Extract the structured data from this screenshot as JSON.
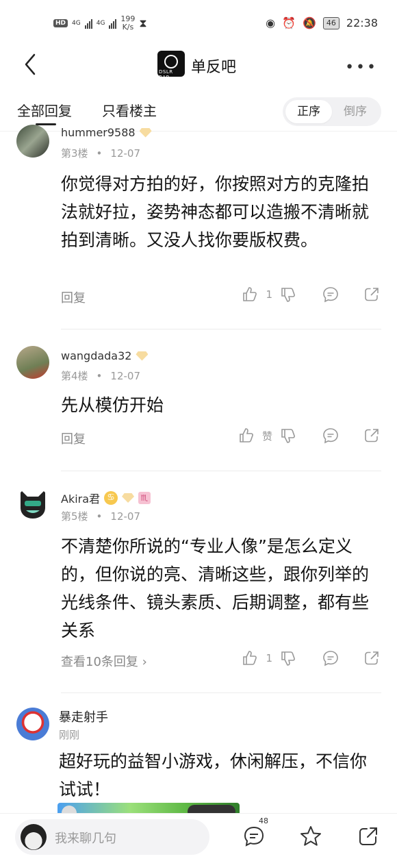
{
  "status_bar": {
    "hd": "HD",
    "sim1": "4G",
    "sim2": "4G",
    "speed_value": "199",
    "speed_unit": "K/s",
    "battery": "46",
    "time": "22:38"
  },
  "header": {
    "logo_text": "DSLR BAR",
    "title": "单反吧"
  },
  "tabs": {
    "all_replies": "全部回复",
    "owner_only": "只看楼主",
    "order_asc": "正序",
    "order_desc": "倒序"
  },
  "posts": [
    {
      "username": "hummer9588",
      "floor": "第3楼",
      "date": "12-07",
      "content": "你觉得对方拍的好，你按照对方的克隆拍法就好拉，姿势神态都可以造搬不清晰就拍到清晰。又没人找你要版权费。",
      "reply_label": "回复",
      "like_text": "1"
    },
    {
      "username": "wangdada32",
      "level": "14",
      "floor": "第4楼",
      "date": "12-07",
      "content": "先从模仿开始",
      "reply_label": "回复",
      "like_text": "赞"
    },
    {
      "username": "Akira君",
      "level": "13",
      "floor": "第5楼",
      "date": "12-07",
      "content": "不清楚你所说的“专业人像”是怎么定义的，但你说的亮、清晰这些，跟你列举的光线条件、镜头素质、后期调整，都有些关系",
      "reply_label": "查看10条回复",
      "like_text": "1"
    },
    {
      "username": "暴走射手",
      "time": "刚刚",
      "content": "超好玩的益智小游戏，休闲解压，不信你试试！"
    }
  ],
  "bottom_bar": {
    "input_placeholder": "我来聊几句",
    "comment_count": "48"
  }
}
